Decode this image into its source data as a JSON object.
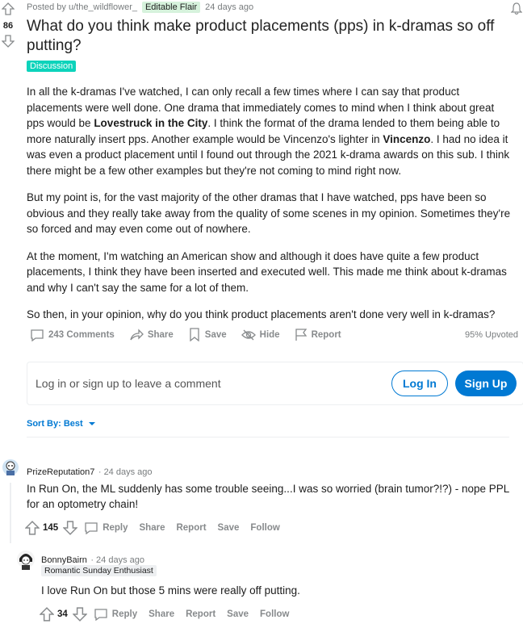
{
  "post": {
    "posted_by": "Posted by u/the_wildflower_",
    "user_flair": "Editable Flair",
    "time": "24 days ago",
    "score": "86",
    "title": "What do you think make product placements (pps) in k-dramas so off putting?",
    "flair": "Discussion",
    "p1_a": "In all the k-dramas I've watched, I can only recall a few times where I can say that product placements were well done. One drama that immediately comes to mind when I think about great pps would be ",
    "p1_b": "Lovestruck in the City",
    "p1_c": ". I think the format of the drama lended to them being able to more naturally insert pps. Another example would be Vincenzo's lighter in ",
    "p1_d": "Vincenzo",
    "p1_e": ". I had no idea it was even a product placement until I found out through the 2021 k-drama awards on this sub. I think there might be a few other examples but they're not coming to mind right now.",
    "p2": "But my point is, for the vast majority of the other dramas that I have watched, pps have been so obvious and they really take away from the quality of some scenes in my opinion. Sometimes they're so forced and may even come out of nowhere.",
    "p3": "At the moment, I'm watching an American show and although it does have quite a few product placements, I think they have been inserted and executed well. This made me think about k-dramas and why I can't say the same for a lot of them.",
    "p4": "So then, in your opinion, why do you think product placements aren't done very well in k-dramas?"
  },
  "actions": {
    "comments": "243 Comments",
    "share": "Share",
    "save": "Save",
    "hide": "Hide",
    "report": "Report",
    "upvoted": "95% Upvoted"
  },
  "comment_box": {
    "prompt": "Log in or sign up to leave a comment",
    "login": "Log In",
    "signup": "Sign Up"
  },
  "sort": {
    "label": "Sort By: Best"
  },
  "comments": [
    {
      "author": "PrizeReputation7",
      "time": "· 24 days ago",
      "text": "In Run On, the ML suddenly has some trouble seeing...I was so worried (brain tumor?!?) - nope PPL for an optometry chain!",
      "score": "145",
      "reply": "Reply",
      "share": "Share",
      "report": "Report",
      "save": "Save",
      "follow": "Follow"
    },
    {
      "author": "BonnyBairn",
      "time": "· 24 days ago",
      "flair": "Romantic Sunday Enthusiast",
      "text": "I love Run On but those 5 mins were really off putting.",
      "score": "34",
      "reply": "Reply",
      "share": "Share",
      "report": "Report",
      "save": "Save",
      "follow": "Follow"
    }
  ]
}
